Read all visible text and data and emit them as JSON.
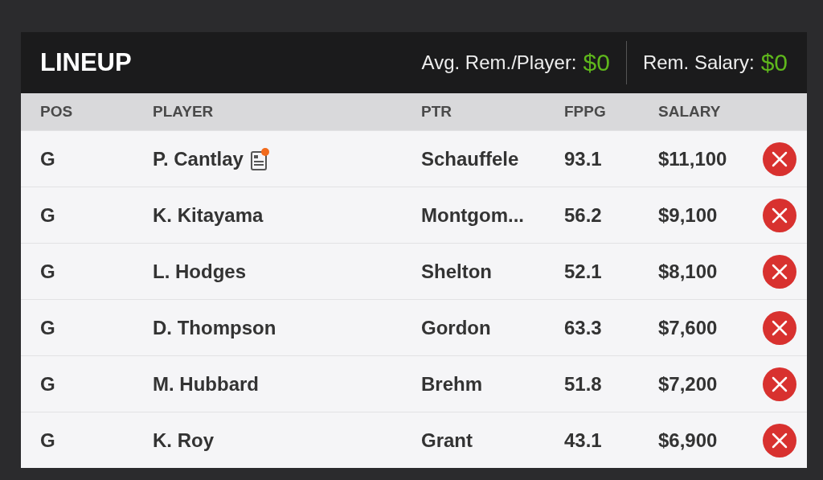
{
  "lineup": {
    "title": "LINEUP",
    "stats": [
      {
        "label": "Avg. Rem./Player:",
        "value": "$0"
      },
      {
        "label": "Rem. Salary:",
        "value": "$0"
      }
    ],
    "columns": [
      "POS",
      "PLAYER",
      "PTR",
      "FPPG",
      "SALARY"
    ],
    "rows": [
      {
        "pos": "G",
        "player": "P. Cantlay",
        "news": true,
        "ptr": "Schauffele",
        "fppg": "93.1",
        "salary": "$11,100"
      },
      {
        "pos": "G",
        "player": "K. Kitayama",
        "news": false,
        "ptr": "Montgom...",
        "fppg": "56.2",
        "salary": "$9,100"
      },
      {
        "pos": "G",
        "player": "L. Hodges",
        "news": false,
        "ptr": "Shelton",
        "fppg": "52.1",
        "salary": "$8,100"
      },
      {
        "pos": "G",
        "player": "D. Thompson",
        "news": false,
        "ptr": "Gordon",
        "fppg": "63.3",
        "salary": "$7,600"
      },
      {
        "pos": "G",
        "player": "M. Hubbard",
        "news": false,
        "ptr": "Brehm",
        "fppg": "51.8",
        "salary": "$7,200"
      },
      {
        "pos": "G",
        "player": "K. Roy",
        "news": false,
        "ptr": "Grant",
        "fppg": "43.1",
        "salary": "$6,900"
      }
    ]
  }
}
